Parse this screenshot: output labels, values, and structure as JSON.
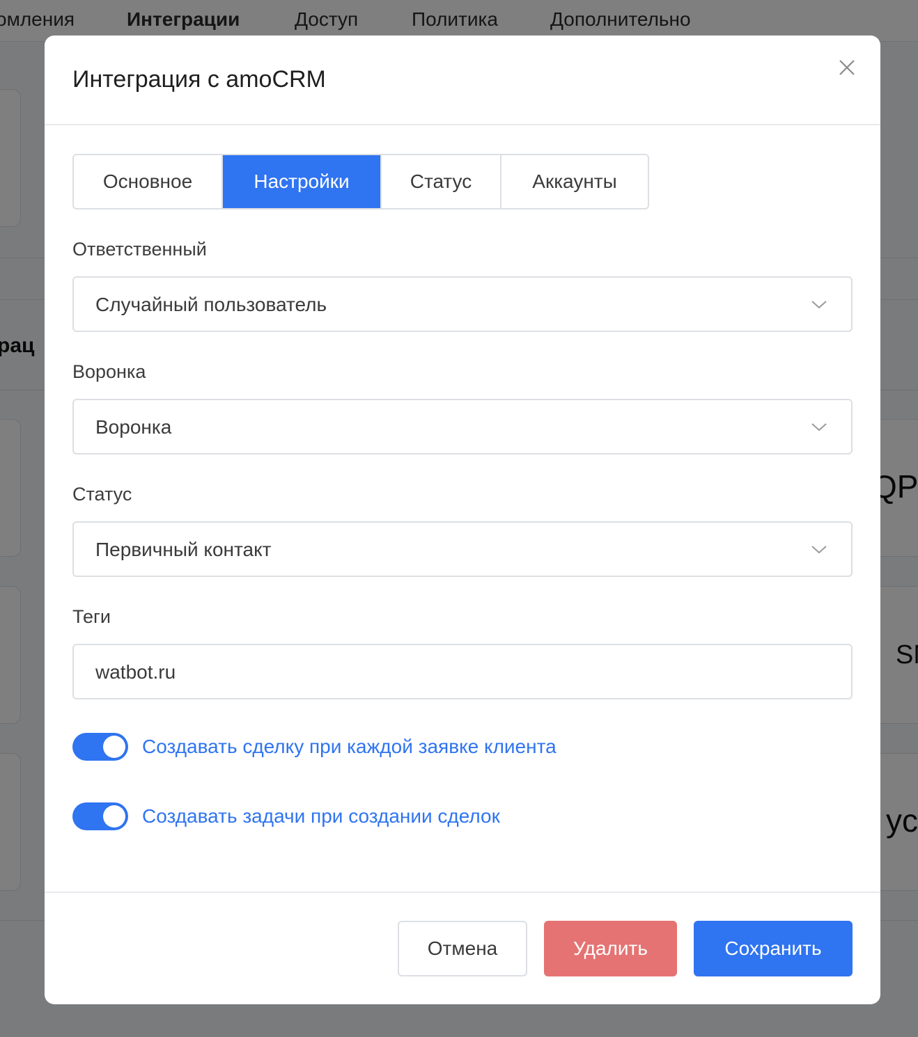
{
  "background": {
    "nav_items": [
      {
        "label": "омления",
        "active": false
      },
      {
        "label": "Интеграции",
        "active": true
      },
      {
        "label": "Доступ",
        "active": false
      },
      {
        "label": "Политика",
        "active": false
      },
      {
        "label": "Дополнительно",
        "active": false
      }
    ],
    "section_heading": "рац",
    "logo_fragments": [
      "QP",
      "SM",
      "yc"
    ]
  },
  "modal": {
    "title": "Интеграция с amoCRM",
    "tabs": [
      {
        "label": "Основное",
        "active": false
      },
      {
        "label": "Настройки",
        "active": true
      },
      {
        "label": "Статус",
        "active": false
      },
      {
        "label": "Аккаунты",
        "active": false
      }
    ],
    "fields": {
      "responsible": {
        "label": "Ответственный",
        "value": "Случайный пользователь"
      },
      "funnel": {
        "label": "Воронка",
        "value": "Воронка"
      },
      "status": {
        "label": "Статус",
        "value": "Первичный контакт"
      },
      "tags": {
        "label": "Теги",
        "value": "watbot.ru"
      }
    },
    "toggles": [
      {
        "label": "Создавать сделку при каждой заявке клиента",
        "on": true
      },
      {
        "label": "Создавать задачи при создании сделок",
        "on": true
      }
    ],
    "buttons": {
      "cancel": "Отмена",
      "delete": "Удалить",
      "save": "Сохранить"
    }
  },
  "colors": {
    "accent": "#2f74f0",
    "danger": "#e57373",
    "overlay": "rgba(0,0,0,0.5)"
  },
  "icons": {
    "close": "close-icon",
    "dropdown": "chevron-down-icon"
  }
}
